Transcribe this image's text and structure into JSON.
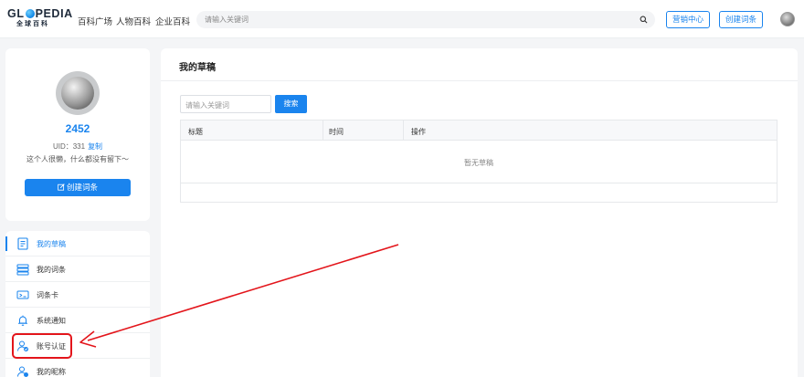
{
  "header": {
    "logo_text_left": "GL",
    "logo_text_right": "PEDIA",
    "logo_subtitle": "全球百科",
    "nav": [
      "百科广场",
      "人物百科",
      "企业百科"
    ],
    "search_placeholder": "请输入关键词",
    "marketing_label": "营销中心",
    "create_entry_label": "创建词条"
  },
  "profile": {
    "name": "2452",
    "uid_label": "UID：331",
    "copy_label": "复制",
    "bio": "这个人很懒，什么都没有留下～",
    "create_button_label": "创建词条"
  },
  "menu": {
    "items": [
      {
        "label": "我的草稿",
        "icon": "draft-icon",
        "active": true
      },
      {
        "label": "我的词条",
        "icon": "entries-icon",
        "active": false
      },
      {
        "label": "词条卡",
        "icon": "card-icon",
        "active": false
      },
      {
        "label": "系统通知",
        "icon": "bell-icon",
        "active": false
      },
      {
        "label": "账号认证",
        "icon": "user-verify-icon",
        "active": false
      },
      {
        "label": "我的昵称",
        "icon": "user-edit-icon",
        "active": false
      }
    ]
  },
  "main": {
    "title": "我的草稿",
    "keyword_placeholder": "请输入关键词",
    "search_button": "搜索",
    "columns": [
      "标题",
      "时间",
      "操作"
    ],
    "empty_text": "暂无草稿"
  },
  "colors": {
    "accent": "#1a84ee",
    "annotation": "#e3151b"
  }
}
